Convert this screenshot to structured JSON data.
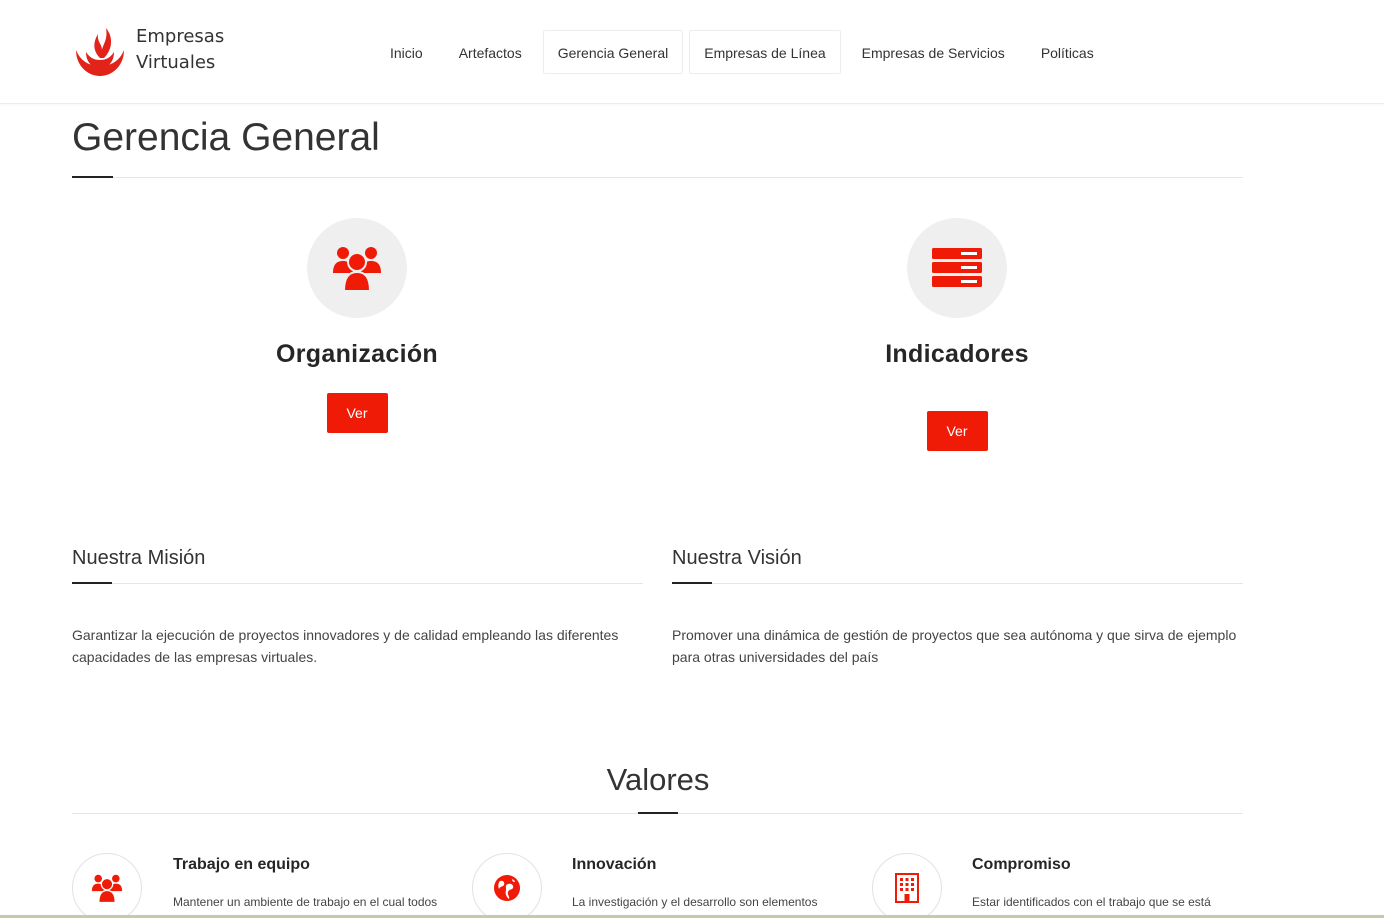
{
  "brand": {
    "line1": "Empresas",
    "line2": "Virtuales",
    "accent_color": "#f01b06"
  },
  "nav": {
    "items": [
      {
        "label": "Inicio"
      },
      {
        "label": "Artefactos"
      },
      {
        "label": "Gerencia General"
      },
      {
        "label": "Empresas de Línea"
      },
      {
        "label": "Empresas de Servicios"
      },
      {
        "label": "Políticas"
      }
    ]
  },
  "page": {
    "title": "Gerencia General"
  },
  "features": [
    {
      "title": "Organización",
      "button": "Ver",
      "icon": "users-icon"
    },
    {
      "title": "Indicadores",
      "button": "Ver",
      "icon": "server-icon"
    }
  ],
  "mission": {
    "title": "Nuestra Misión",
    "text": "Garantizar la ejecución de proyectos innovadores y de calidad empleando las diferentes capacidades de las empresas virtuales."
  },
  "vision": {
    "title": "Nuestra Visión",
    "text": "Promover una dinámica de gestión de proyectos que sea autónoma y que sirva de ejemplo para otras universidades del país"
  },
  "values": {
    "title": "Valores",
    "items": [
      {
        "title": "Trabajo en equipo",
        "text": "Mantener un ambiente de trabajo en el cual todos",
        "icon": "users-icon"
      },
      {
        "title": "Innovación",
        "text": "La investigación y el desarrollo son elementos",
        "icon": "globe-icon"
      },
      {
        "title": "Compromiso",
        "text": "Estar identificados con el trabajo que se está",
        "icon": "building-icon"
      }
    ]
  }
}
